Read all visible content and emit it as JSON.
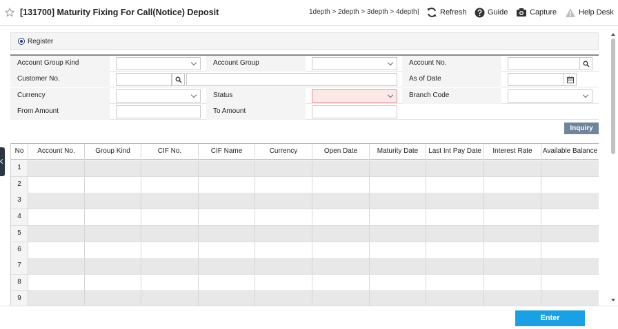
{
  "header": {
    "title": "[131700] Maturity Fixing For Call(Notice) Deposit",
    "breadcrumb": "1depth > 2depth > 3depth > 4depth",
    "separator": "|",
    "tools": {
      "refresh": "Refresh",
      "guide": "Guide",
      "capture": "Capture",
      "help": "Help Desk"
    }
  },
  "register": {
    "label": "Register",
    "selected": true
  },
  "form": {
    "account_group_kind": {
      "label": "Account Group Kind",
      "value": ""
    },
    "account_group": {
      "label": "Account Group",
      "value": ""
    },
    "account_no": {
      "label": "Account No.",
      "value": ""
    },
    "customer_no": {
      "label": "Customer No.",
      "value": "",
      "name_value": ""
    },
    "as_of_date": {
      "label": "As of Date",
      "value": ""
    },
    "currency": {
      "label": "Currency",
      "value": ""
    },
    "status": {
      "label": "Status",
      "value": ""
    },
    "branch_code": {
      "label": "Branch Code",
      "value": ""
    },
    "from_amount": {
      "label": "From Amount",
      "value": ""
    },
    "to_amount": {
      "label": "To Amount",
      "value": ""
    }
  },
  "inquiry_label": "Inquiry",
  "grid": {
    "columns": [
      "No",
      "Account No.",
      "Group Kind",
      "CIF No.",
      "CIF Name",
      "Currency",
      "Open Date",
      "Maturity Date",
      "Last Int Pay Date",
      "Interest Rate",
      "Available Balance"
    ],
    "rows": [
      "1",
      "2",
      "3",
      "4",
      "5",
      "6",
      "7",
      "8",
      "9"
    ]
  },
  "enter_label": "Enter",
  "icons": {
    "favorite": "star-icon",
    "refresh": "refresh-icon",
    "guide": "question-circle-icon",
    "capture": "camera-icon",
    "help": "warning-triangle-icon",
    "search": "search-icon",
    "calendar": "calendar-icon",
    "dropdown": "chevron-down-icon"
  },
  "colors": {
    "inquiry_button": "#6f859d",
    "enter_button": "#1aa1e5",
    "status_field": "#fde8e8",
    "sidebar_handle": "#2b3742"
  }
}
